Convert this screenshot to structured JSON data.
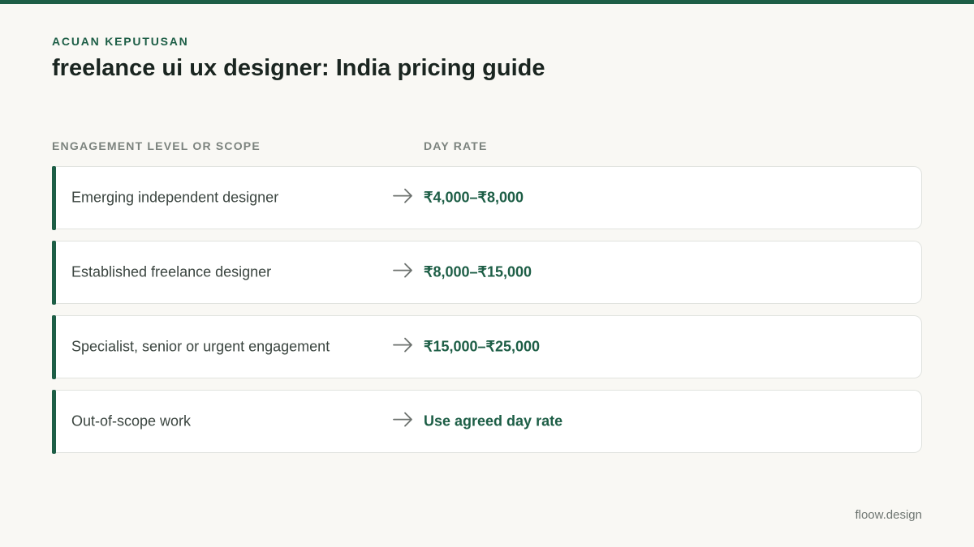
{
  "header": {
    "eyebrow": "ACUAN KEPUTUSAN",
    "title": "freelance ui ux designer: India pricing guide"
  },
  "table": {
    "columns": {
      "scope": "ENGAGEMENT LEVEL OR SCOPE",
      "rate": "DAY RATE"
    },
    "rows": [
      {
        "scope": "Emerging independent designer",
        "arrow_icon": "arrow-right-icon",
        "rate": "₹4,000–₹8,000"
      },
      {
        "scope": "Established freelance designer",
        "arrow_icon": "arrow-right-icon",
        "rate": "₹8,000–₹15,000"
      },
      {
        "scope": "Specialist, senior or urgent engagement",
        "arrow_icon": "arrow-right-icon",
        "rate": "₹15,000–₹25,000"
      },
      {
        "scope": "Out-of-scope work",
        "arrow_icon": "arrow-right-icon",
        "rate": "Use agreed day rate"
      }
    ]
  },
  "footer": {
    "brand": "floow.design"
  },
  "colors": {
    "accent": "#1d5e46",
    "background": "#f9f8f4",
    "card": "#ffffff",
    "muted_text": "#7c837e"
  }
}
